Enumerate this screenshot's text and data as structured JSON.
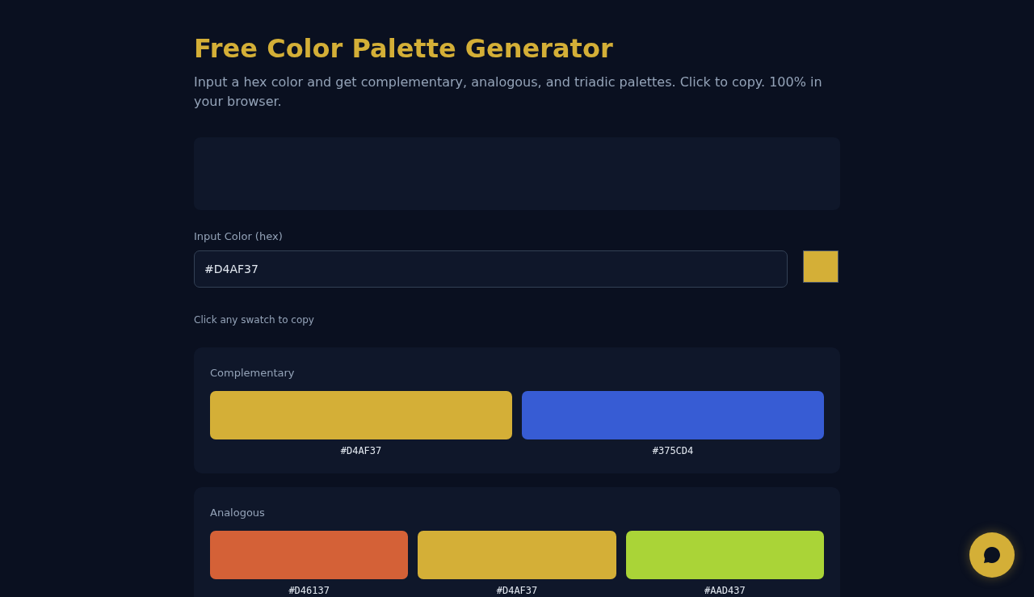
{
  "header": {
    "title": "Free Color Palette Generator",
    "subtitle": "Input a hex color and get complementary, analogous, and triadic palettes. Click to copy. 100% in your browser."
  },
  "input": {
    "label": "Input Color (hex)",
    "value": "#D4AF37",
    "color": "#d4af37"
  },
  "hint": "Click any swatch to copy",
  "palettes": [
    {
      "name": "Complementary",
      "swatches": [
        {
          "hex": "#D4AF37",
          "color": "#d4af37"
        },
        {
          "hex": "#375CD4",
          "color": "#375cd4"
        }
      ]
    },
    {
      "name": "Analogous",
      "swatches": [
        {
          "hex": "#D46137",
          "color": "#d46137"
        },
        {
          "hex": "#D4AF37",
          "color": "#d4af37"
        },
        {
          "hex": "#AAD437",
          "color": "#aad437"
        }
      ]
    }
  ]
}
